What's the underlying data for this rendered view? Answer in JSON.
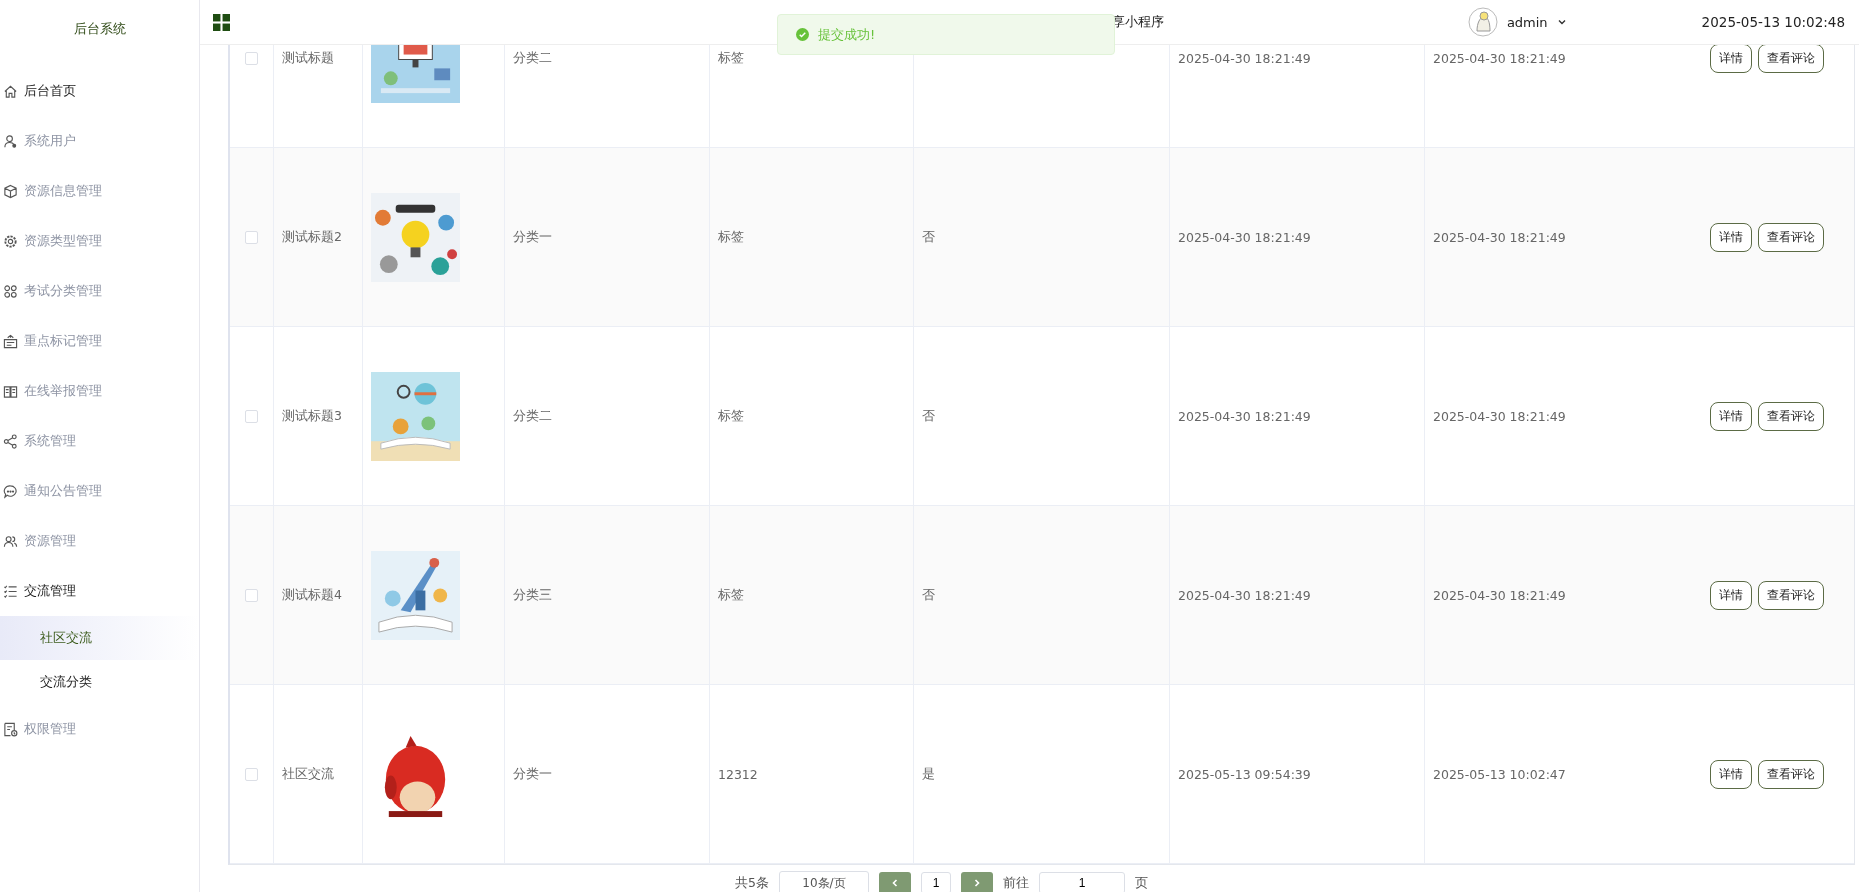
{
  "sidebar": {
    "title": "后台系统",
    "items": [
      {
        "label": "后台首页",
        "active": true
      },
      {
        "label": "系统用户",
        "active": false
      },
      {
        "label": "资源信息管理",
        "active": false
      },
      {
        "label": "资源类型管理",
        "active": false
      },
      {
        "label": "考试分类管理",
        "active": false
      },
      {
        "label": "重点标记管理",
        "active": false
      },
      {
        "label": "在线举报管理",
        "active": false
      },
      {
        "label": "系统管理",
        "active": false
      },
      {
        "label": "通知公告管理",
        "active": false
      },
      {
        "label": "资源管理",
        "active": false
      },
      {
        "label": "交流管理",
        "active": true,
        "children": [
          {
            "label": "社区交流",
            "selected": true
          },
          {
            "label": "交流分类",
            "selected": false
          }
        ]
      },
      {
        "label": "权限管理",
        "active": false
      }
    ]
  },
  "header": {
    "page_title": "享小程序",
    "user": "admin",
    "datetime": "2025-05-13 10:02:48"
  },
  "toast": {
    "message": "提交成功!"
  },
  "table": {
    "rows": [
      {
        "checked": false,
        "title": "测试标题",
        "category": "分类二",
        "tag": "标签",
        "created": "2025-04-30 18:21:49",
        "updated": "2025-04-30 18:21:49",
        "actions": [
          "详情",
          "查看评论"
        ]
      },
      {
        "checked": false,
        "title": "测试标题2",
        "category": "分类一",
        "tag": "标签",
        "flag": "否",
        "created": "2025-04-30 18:21:49",
        "updated": "2025-04-30 18:21:49",
        "actions": [
          "详情",
          "查看评论"
        ]
      },
      {
        "checked": false,
        "title": "测试标题3",
        "category": "分类二",
        "tag": "标签",
        "flag": "否",
        "created": "2025-04-30 18:21:49",
        "updated": "2025-04-30 18:21:49",
        "actions": [
          "详情",
          "查看评论"
        ]
      },
      {
        "checked": false,
        "title": "测试标题4",
        "category": "分类三",
        "tag": "标签",
        "flag": "否",
        "created": "2025-04-30 18:21:49",
        "updated": "2025-04-30 18:21:49",
        "actions": [
          "详情",
          "查看评论"
        ]
      },
      {
        "checked": false,
        "title": "社区交流",
        "category": "分类一",
        "tag": "12312",
        "flag": "是",
        "created": "2025-05-13 09:54:39",
        "updated": "2025-05-13 10:02:47",
        "actions": [
          "详情",
          "查看评论"
        ]
      }
    ]
  },
  "pagination": {
    "total": "共5条",
    "page_size": "10条/页",
    "pages": [
      {
        "label": "1",
        "selected": false
      }
    ],
    "goto_label": "前往",
    "goto_value": "1",
    "goto_unit": "页"
  }
}
